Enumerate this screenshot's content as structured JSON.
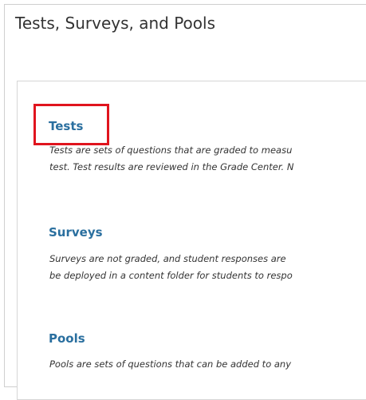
{
  "page": {
    "title": "Tests, Surveys, and Pools"
  },
  "sections": [
    {
      "title": "Tests",
      "desc_line1": "Tests are sets of questions that are graded to measu",
      "desc_line2": "test. Test results are reviewed in the Grade Center. N"
    },
    {
      "title": "Surveys",
      "desc_line1": "Surveys are not graded, and student responses are",
      "desc_line2": "be deployed in a content folder for students to respo"
    },
    {
      "title": "Pools",
      "desc_line1": "Pools are sets of questions that can be added to any"
    }
  ],
  "colors": {
    "link": "#2a6f9f",
    "highlight": "#e0141e",
    "border": "#d6d6d6"
  }
}
